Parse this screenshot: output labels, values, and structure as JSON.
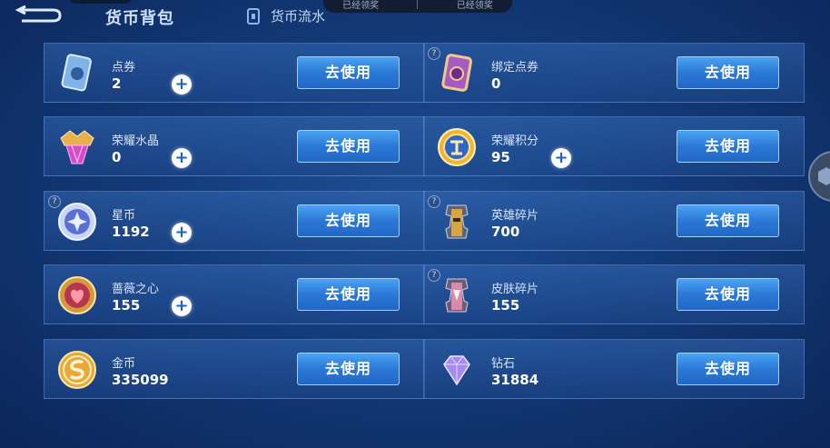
{
  "header": {
    "title": "货币背包",
    "flow_tab": "货币流水",
    "top_pill_left": "已经领奖",
    "top_pill_right": "已经领奖"
  },
  "cards": [
    {
      "name": "点券",
      "amount": "2",
      "button": "去使用",
      "has_plus": true,
      "has_help": false,
      "icon": "voucher-icon"
    },
    {
      "name": "绑定点券",
      "amount": "0",
      "button": "去使用",
      "has_plus": false,
      "has_help": true,
      "icon": "bound-voucher-icon"
    },
    {
      "name": "荣耀水晶",
      "amount": "0",
      "button": "去使用",
      "has_plus": true,
      "has_help": false,
      "icon": "glory-crystal-icon"
    },
    {
      "name": "荣耀积分",
      "amount": "95",
      "button": "去使用",
      "has_plus": true,
      "has_help": false,
      "icon": "glory-points-icon"
    },
    {
      "name": "星币",
      "amount": "1192",
      "button": "去使用",
      "has_plus": true,
      "has_help": true,
      "icon": "star-coin-icon"
    },
    {
      "name": "英雄碎片",
      "amount": "700",
      "button": "去使用",
      "has_plus": false,
      "has_help": true,
      "icon": "hero-shard-icon"
    },
    {
      "name": "蔷薇之心",
      "amount": "155",
      "button": "去使用",
      "has_plus": true,
      "has_help": false,
      "icon": "rose-heart-icon"
    },
    {
      "name": "皮肤碎片",
      "amount": "155",
      "button": "去使用",
      "has_plus": false,
      "has_help": true,
      "icon": "skin-shard-icon"
    },
    {
      "name": "金币",
      "amount": "335099",
      "button": "去使用",
      "has_plus": false,
      "has_help": false,
      "icon": "gold-coin-icon"
    },
    {
      "name": "钻石",
      "amount": "31884",
      "button": "去使用",
      "has_plus": false,
      "has_help": false,
      "icon": "diamond-icon"
    }
  ],
  "plus_symbol": "+",
  "help_symbol": "?"
}
